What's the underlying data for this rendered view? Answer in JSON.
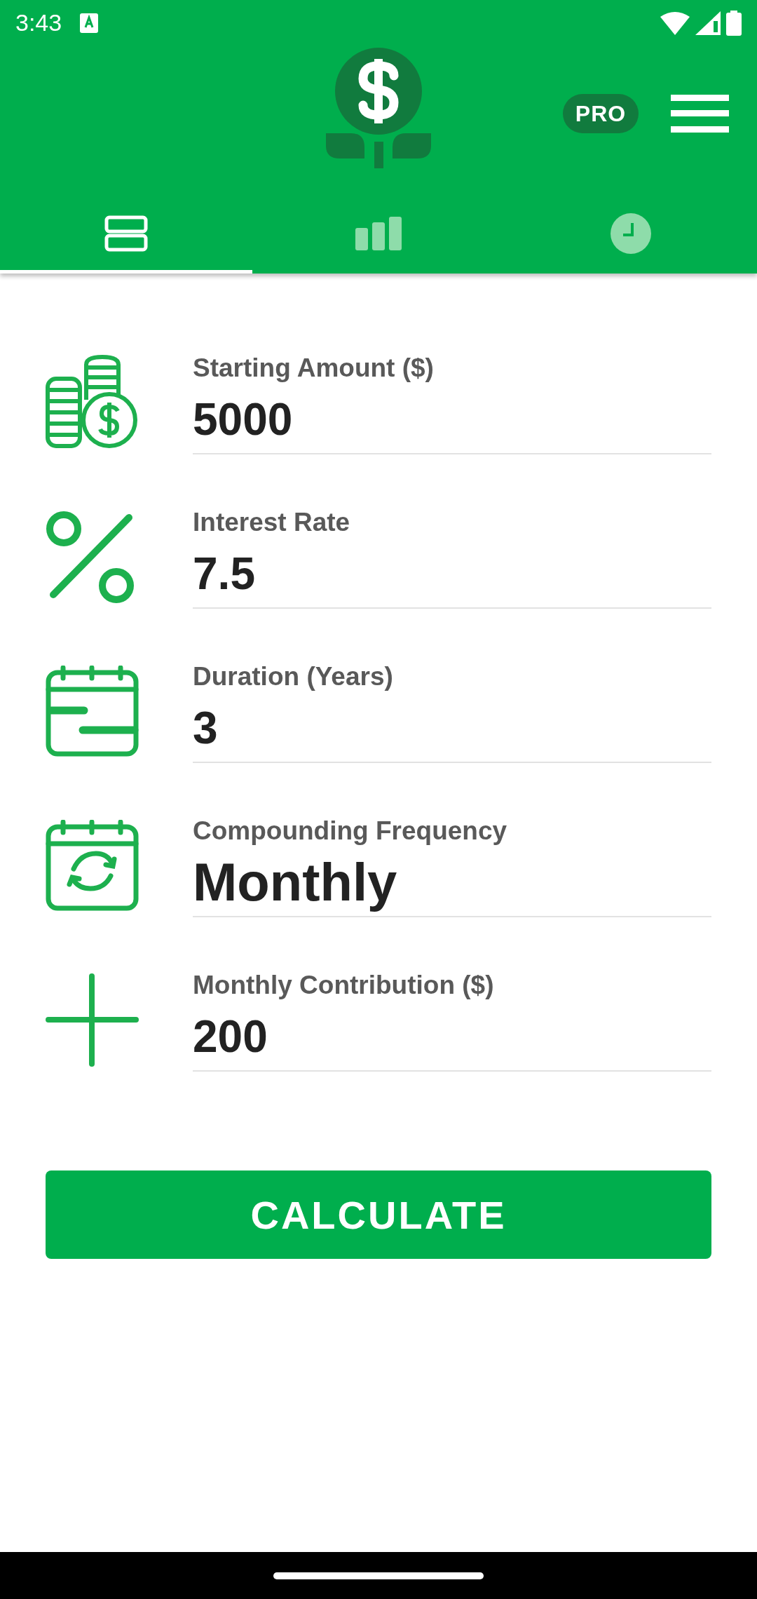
{
  "status_bar": {
    "time": "3:43"
  },
  "header": {
    "pro_badge": "PRO"
  },
  "tabs": [
    {
      "selected": true
    },
    {
      "selected": false
    },
    {
      "selected": false
    }
  ],
  "fields": [
    {
      "label": "Starting Amount ($)",
      "value": "5000",
      "kind": "number"
    },
    {
      "label": "Interest Rate",
      "value": "7.5",
      "kind": "number"
    },
    {
      "label": "Duration (Years)",
      "value": "3",
      "kind": "number"
    },
    {
      "label": "Compounding Frequency",
      "value": "Monthly",
      "kind": "select"
    },
    {
      "label": "Monthly Contribution ($)",
      "value": "200",
      "kind": "number"
    }
  ],
  "calculate_button": "CALCULATE"
}
